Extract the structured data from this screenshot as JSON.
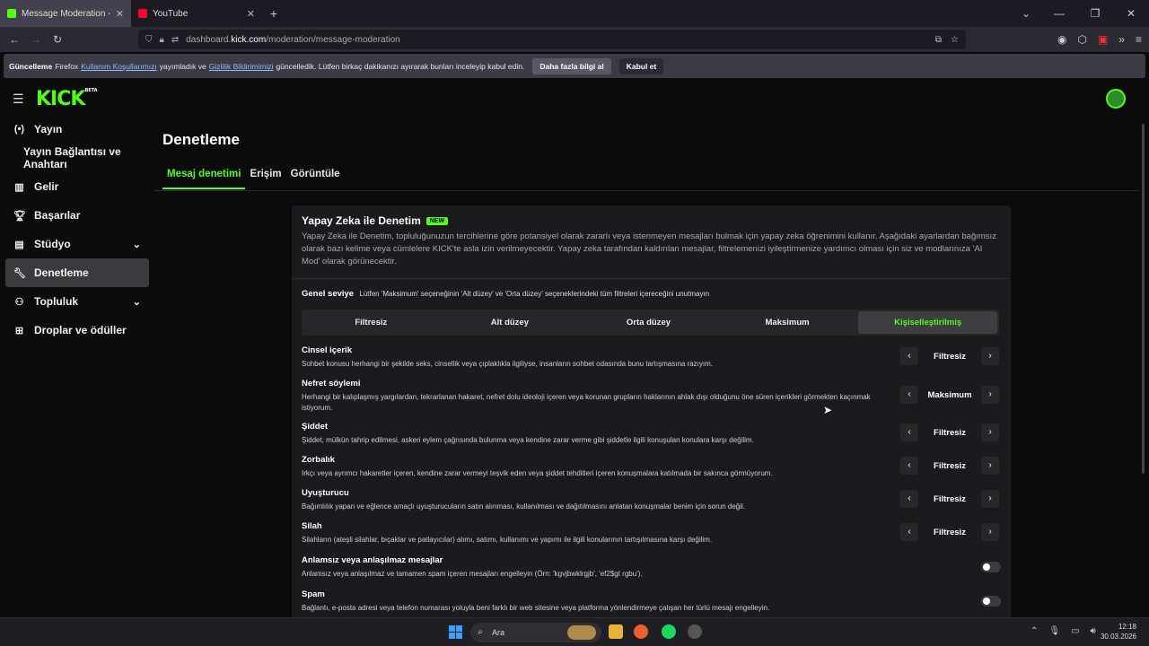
{
  "browser": {
    "tabs": [
      {
        "title": "Message Moderation - Kick Da",
        "active": true
      },
      {
        "title": "YouTube",
        "active": false
      }
    ],
    "url_prefix": "dashboard.",
    "url_host": "kick.com",
    "url_path": "/moderation/message-moderation"
  },
  "notice": {
    "bold": "Güncelleme",
    "text1": "Firefox",
    "link1": "Kullanım Koşullarımızı",
    "text2": "yayımladık ve",
    "link2": "Gizlilik Bildirimimizi",
    "text3": "güncelledik. Lütfen birkaç dakikanızı ayırarak bunları inceleyip kabul edin.",
    "btn_more": "Daha fazla bilgi al",
    "btn_accept": "Kabul et"
  },
  "app": {
    "logo": "KICK",
    "logo_badge": "BETA"
  },
  "sidebar": {
    "items": [
      {
        "label": "Yayın",
        "icon": "broadcast-icon"
      },
      {
        "label": "Yayın Bağlantısı ve Anahtarı",
        "icon": ""
      },
      {
        "label": "Gelir",
        "icon": "chart-icon"
      },
      {
        "label": "Başarılar",
        "icon": "trophy-icon"
      },
      {
        "label": "Stüdyo",
        "icon": "studio-icon"
      },
      {
        "label": "Denetleme",
        "icon": "wrench-icon"
      },
      {
        "label": "Topluluk",
        "icon": "community-icon"
      },
      {
        "label": "Droplar ve ödüller",
        "icon": "drops-icon"
      }
    ]
  },
  "page": {
    "title": "Denetleme",
    "tabs": [
      "Mesaj denetimi",
      "Erişim",
      "Görüntüle"
    ]
  },
  "card": {
    "title": "Yapay Zeka ile Denetim",
    "badge": "NEW",
    "description": "Yapay Zeka ile Denetim, topluluğunuzun tercihlerine göre potansiyel olarak zararlı veya istenmeyen mesajları bulmak için yapay zeka öğrenimini kullanır. Aşağıdaki ayarlardan bağımsız olarak bazı kelime veya cümlelere KICK'te asla izin verilmeyecektir. Yapay zeka tarafından kaldırılan mesajlar, filtrelemenizi iyileştirmenize yardımcı olması için siz ve modlarınıza 'AI Mod' olarak görünecektir.",
    "level_label": "Genel seviye",
    "level_hint": "Lütfen 'Maksimum' seçeneğinin 'Alt düzey' ve 'Orta düzey' seçeneklerindeki tüm filtreleri içereceğini unutmayın",
    "levels": [
      "Filtresiz",
      "Alt düzey",
      "Orta düzey",
      "Maksimum",
      "Kişiselleştirilmiş"
    ],
    "categories": [
      {
        "name": "Cinsel içerik",
        "desc": "Sohbet konusu herhangi bir şekilde seks, cinsellik veya çıplaklıkla ilgiliyse, insanların sohbet odasında bunu tartışmasına razıyım.",
        "value": "Filtresiz"
      },
      {
        "name": "Nefret söylemi",
        "desc": "Herhangi bir kalıplaşmış yargılardan, tekrarlanan hakaret, nefret dolu ideoloji içeren veya korunan grupların haklarının ahlak dışı olduğunu öne süren içerikleri görmekten kaçınmak istiyorum.",
        "value": "Maksimum"
      },
      {
        "name": "Şiddet",
        "desc": "Şiddet, mülkün tahrip edilmesi, askeri eylem çağrısında bulunma veya kendine zarar verme gibi şiddetle ilgili konuşulan konulara karşı değilim.",
        "value": "Filtresiz"
      },
      {
        "name": "Zorbalık",
        "desc": "Irkçı veya ayrımcı hakaretler içeren, kendine zarar vermeyi teşvik eden veya şiddet tehditleri içeren konuşmalara katılmada bir sakınca görmüyorum.",
        "value": "Filtresiz"
      },
      {
        "name": "Uyuşturucu",
        "desc": "Bağımlılık yapan ve eğlence amaçlı uyuşturucuların satın alınması, kullanılması ve dağıtılmasını anlatan konuşmalar benim için sorun değil.",
        "value": "Filtresiz"
      },
      {
        "name": "Silah",
        "desc": "Silahların (ateşli silahlar, bıçaklar ve patlayıcılar) alımı, satımı, kullanımı ve yapımı ile ilgili konularının tartışılmasına karşı değilim.",
        "value": "Filtresiz"
      }
    ],
    "toggles": [
      {
        "name": "Anlamsız veya anlaşılmaz mesajlar",
        "desc": "Anlamsız veya anlaşılmaz ve tamamen spam içeren mesajları engelleyin (Örn: 'kgvjbwklrgjb', 'ef2$gt rgbu').",
        "on": false
      },
      {
        "name": "Spam",
        "desc": "Bağlantı, e-posta adresi veya telefon numarası yoluyla beni farklı bir web sitesine veya platforma yönlendirmeye çalışan her türlü mesajı engelleyin.",
        "on": false
      }
    ]
  },
  "taskbar": {
    "search": "Ara",
    "time": "12:18",
    "date": "30.03.2026"
  },
  "colors": {
    "accent": "#53fc18",
    "background": "#0b0b0c",
    "card": "#1b1b1e"
  }
}
